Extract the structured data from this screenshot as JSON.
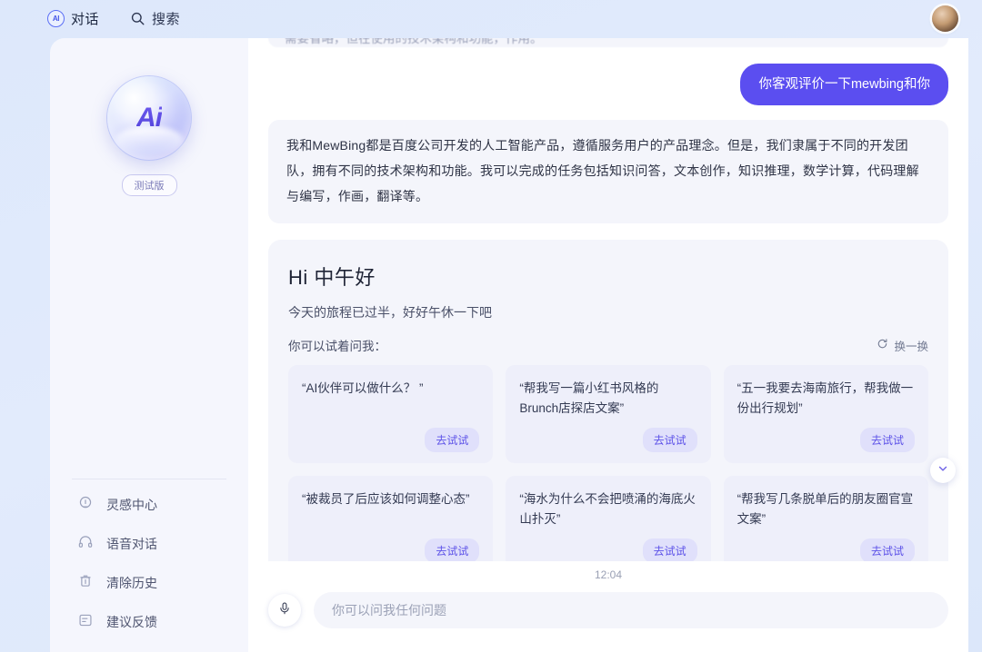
{
  "topbar": {
    "tabs": [
      {
        "label": "对话",
        "icon": "ai-badge-icon",
        "active": true
      },
      {
        "label": "搜索",
        "icon": "search-icon",
        "active": false
      }
    ],
    "avatar_icon": "user-avatar"
  },
  "sidebar": {
    "logo_text": "Ai",
    "badge": "测试版",
    "items": [
      {
        "label": "灵感中心",
        "icon": "lightbulb-icon"
      },
      {
        "label": "语音对话",
        "icon": "headphones-icon"
      },
      {
        "label": "清除历史",
        "icon": "trash-icon"
      },
      {
        "label": "建议反馈",
        "icon": "feedback-icon"
      }
    ]
  },
  "chat": {
    "clipped_message": "需要省略，但在使用的技术架构和功能，作用。",
    "user_message": "你客观评价一下mewbing和你",
    "ai_message": "我和MewBing都是百度公司开发的人工智能产品，遵循服务用户的产品理念。但是，我们隶属于不同的开发团队，拥有不同的技术架构和功能。我可以完成的任务包括知识问答，文本创作，知识推理，数学计算，代码理解与编写，作画，翻译等。",
    "timestamp": "12:04"
  },
  "greeting": {
    "title": "Hi 中午好",
    "subtitle": "今天的旅程已过半，好好午休一下吧",
    "hint": "你可以试着问我：",
    "refresh_label": "换一换",
    "refresh_icon": "refresh-icon",
    "cards": [
      {
        "text": "“AI伙伴可以做什么？ ”",
        "button": "去试试"
      },
      {
        "text": "“帮我写一篇小红书风格的Brunch店探店文案”",
        "button": "去试试"
      },
      {
        "text": "“五一我要去海南旅行，帮我做一份出行规划”",
        "button": "去试试"
      },
      {
        "text": "“被裁员了后应该如何调整心态”",
        "button": "去试试"
      },
      {
        "text": "“海水为什么不会把喷涌的海底火山扑灭”",
        "button": "去试试"
      },
      {
        "text": "“帮我写几条脱单后的朋友圈官宣文案”",
        "button": "去试试"
      }
    ]
  },
  "composer": {
    "mic_icon": "microphone-icon",
    "placeholder": "你可以问我任何问题",
    "value": ""
  },
  "scroll_button": {
    "icon": "chevron-down-icon"
  },
  "colors": {
    "accent": "#5b4ef0",
    "card_bg": "#eeeffa",
    "panel_bg": "#f4f5fb",
    "sidebar_bg": "#f5f6fd",
    "page_bg": "#dfe9fb",
    "btn_text": "#5d52e8"
  }
}
